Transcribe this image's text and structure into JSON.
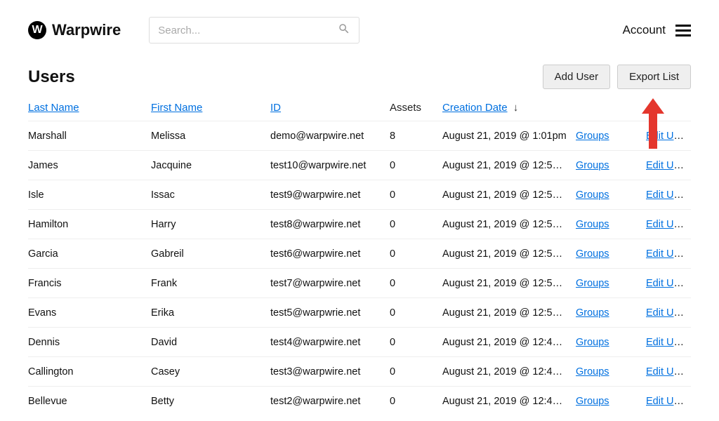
{
  "brand": {
    "badge": "W",
    "name": "Warpwire"
  },
  "search": {
    "placeholder": "Search..."
  },
  "account_label": "Account",
  "page_title": "Users",
  "buttons": {
    "add_user": "Add User",
    "export_list": "Export List"
  },
  "columns": {
    "last_name": "Last Name",
    "first_name": "First Name",
    "id": "ID",
    "assets": "Assets",
    "creation_date": "Creation Date"
  },
  "sort_indicator": "↓",
  "row_links": {
    "groups": "Groups",
    "edit": "Edit User"
  },
  "rows": [
    {
      "last_name": "Marshall",
      "first_name": "Melissa",
      "id": "demo@warpwire.net",
      "assets": "8",
      "created": "August 21, 2019 @ 1:01pm"
    },
    {
      "last_name": "James",
      "first_name": "Jacquine",
      "id": "test10@warpwire.net",
      "assets": "0",
      "created": "August 21, 2019 @ 12:5…"
    },
    {
      "last_name": "Isle",
      "first_name": "Issac",
      "id": "test9@warpwire.net",
      "assets": "0",
      "created": "August 21, 2019 @ 12:5…"
    },
    {
      "last_name": "Hamilton",
      "first_name": "Harry",
      "id": "test8@warpwire.net",
      "assets": "0",
      "created": "August 21, 2019 @ 12:5…"
    },
    {
      "last_name": "Garcia",
      "first_name": "Gabreil",
      "id": "test6@warpwire.net",
      "assets": "0",
      "created": "August 21, 2019 @ 12:5…"
    },
    {
      "last_name": "Francis",
      "first_name": "Frank",
      "id": "test7@warpwire.net",
      "assets": "0",
      "created": "August 21, 2019 @ 12:5…"
    },
    {
      "last_name": "Evans",
      "first_name": "Erika",
      "id": "test5@warpwrie.net",
      "assets": "0",
      "created": "August 21, 2019 @ 12:5…"
    },
    {
      "last_name": "Dennis",
      "first_name": "David",
      "id": "test4@warpwire.net",
      "assets": "0",
      "created": "August 21, 2019 @ 12:4…"
    },
    {
      "last_name": "Callington",
      "first_name": "Casey",
      "id": "test3@warpwire.net",
      "assets": "0",
      "created": "August 21, 2019 @ 12:4…"
    },
    {
      "last_name": "Bellevue",
      "first_name": "Betty",
      "id": "test2@warpwire.net",
      "assets": "0",
      "created": "August 21, 2019 @ 12:4…"
    }
  ],
  "colors": {
    "link": "#0070e0",
    "arrow": "#e4362d"
  }
}
